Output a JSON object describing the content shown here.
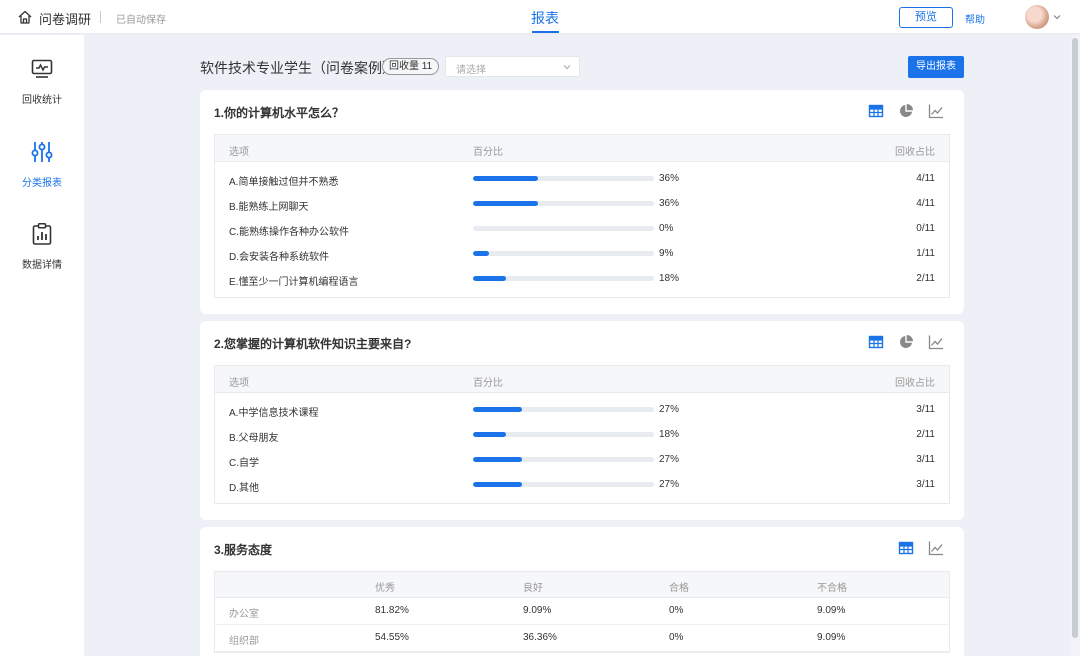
{
  "header": {
    "app_title": "问卷调研",
    "autosave": "已自动保存",
    "active_tab": "报表",
    "preview_label": "预览",
    "help_label": "帮助"
  },
  "sidebar": {
    "items": [
      {
        "label": "回收统计",
        "icon": "monitor-chart-icon"
      },
      {
        "label": "分类报表",
        "icon": "sliders-icon"
      },
      {
        "label": "数据详情",
        "icon": "clipboard-chart-icon"
      }
    ],
    "active_index": 1
  },
  "survey": {
    "title": "软件技术专业学生（问卷案例）",
    "count_label": "回收量 11",
    "select_placeholder": "请选择",
    "export_label": "导出报表"
  },
  "colors": {
    "accent": "#1a73e8",
    "bar_track": "#e8ebf0",
    "page_bg": "#edf0f7"
  },
  "questions": [
    {
      "title": "1.你的计算机水平怎么？",
      "columns": {
        "option": "选项",
        "percent": "百分比",
        "ratio": "回收占比"
      },
      "tools": [
        "table-icon",
        "pie-chart-icon",
        "line-chart-icon"
      ],
      "rows": [
        {
          "option": "A.简单接触过但并不熟悉",
          "percent_label": "36%",
          "percent": 36,
          "ratio": "4/11"
        },
        {
          "option": "B.能熟练上网聊天",
          "percent_label": "36%",
          "percent": 36,
          "ratio": "4/11"
        },
        {
          "option": "C.能熟练操作各种办公软件",
          "percent_label": "0%",
          "percent": 0,
          "ratio": "0/11"
        },
        {
          "option": "D.会安装各种系统软件",
          "percent_label": "9%",
          "percent": 9,
          "ratio": "1/11"
        },
        {
          "option": "E.懂至少一门计算机编程语言",
          "percent_label": "18%",
          "percent": 18,
          "ratio": "2/11"
        }
      ]
    },
    {
      "title": "2.您掌握的计算机软件知识主要来自?",
      "columns": {
        "option": "选项",
        "percent": "百分比",
        "ratio": "回收占比"
      },
      "tools": [
        "table-icon",
        "pie-chart-icon",
        "line-chart-icon"
      ],
      "rows": [
        {
          "option": "A.中学信息技术课程",
          "percent_label": "27%",
          "percent": 27,
          "ratio": "3/11"
        },
        {
          "option": "B.父母朋友",
          "percent_label": "18%",
          "percent": 18,
          "ratio": "2/11"
        },
        {
          "option": "C.自学",
          "percent_label": "27%",
          "percent": 27,
          "ratio": "3/11"
        },
        {
          "option": "D.其他",
          "percent_label": "27%",
          "percent": 27,
          "ratio": "3/11"
        }
      ]
    }
  ],
  "matrix": {
    "title": "3.服务态度",
    "tools": [
      "table-icon",
      "line-chart-icon"
    ],
    "columns": [
      "",
      "优秀",
      "良好",
      "合格",
      "不合格"
    ],
    "rows": [
      {
        "label": "办公室",
        "values": [
          "81.82%",
          "9.09%",
          "0%",
          "9.09%"
        ]
      },
      {
        "label": "组织部",
        "values": [
          "54.55%",
          "36.36%",
          "0%",
          "9.09%"
        ]
      }
    ]
  }
}
